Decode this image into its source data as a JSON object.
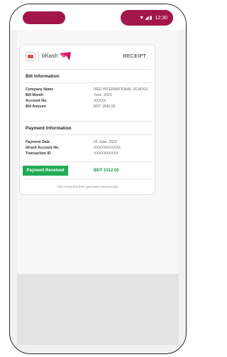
{
  "status_bar": {
    "time": "12:30",
    "signal_icon": "signal-icon",
    "battery_icon": "battery-icon"
  },
  "receipt": {
    "brand": "bKash",
    "title": "RECEIPT",
    "bill_section": {
      "title": "Bill Information",
      "rows": [
        {
          "label": "Company Name",
          "value": "IIIED INTERNATIONAL SCHOOL"
        },
        {
          "label": "Bill Month",
          "value": "June, 2023"
        },
        {
          "label": "Account No.",
          "value": "XXXXX"
        },
        {
          "label": "Bill Amount",
          "value": "BDT 1500.00"
        }
      ]
    },
    "payment_section": {
      "title": "Payment Information",
      "rows": [
        {
          "label": "Payment Date",
          "value": "22 June, 2023"
        },
        {
          "label": "bKash Account No.",
          "value": "XXXXXXXXXXX"
        },
        {
          "label": "Transaction ID",
          "value": "XXXXXXXXXX"
        }
      ]
    },
    "payment_received_label": "Payment Received",
    "payment_received_amount": "BDT 1512.00",
    "footnote": "This receipt has been generated electronically"
  },
  "colors": {
    "accent": "#a3164a",
    "success": "#1faa55"
  }
}
